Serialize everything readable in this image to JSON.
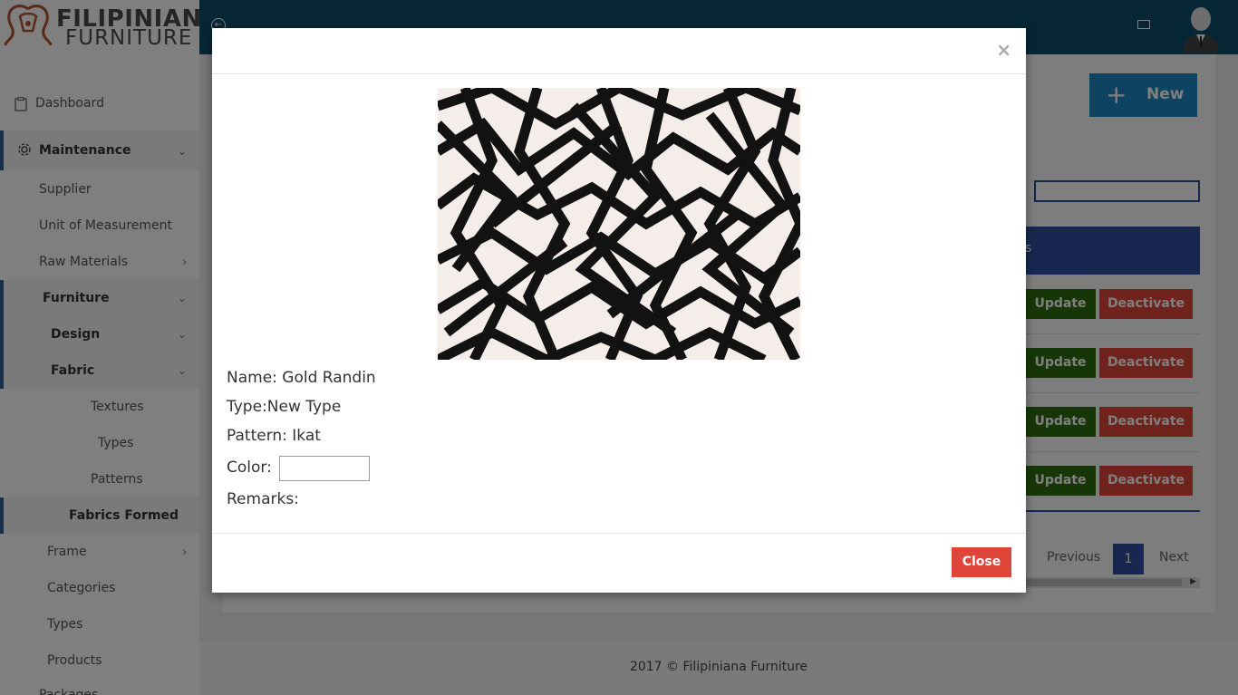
{
  "brand": {
    "line1": "FILIPINIANA",
    "line2": "FURNITURE"
  },
  "sidebar": {
    "items": [
      {
        "label": "Dashboard"
      },
      {
        "label": "Maintenance"
      },
      {
        "label": "Supplier"
      },
      {
        "label": "Unit of Measurement"
      },
      {
        "label": "Raw Materials"
      },
      {
        "label": "Furniture"
      },
      {
        "label": "Design"
      },
      {
        "label": "Fabric"
      },
      {
        "label": "Textures"
      },
      {
        "label": "Types"
      },
      {
        "label": "Patterns"
      },
      {
        "label": "Fabrics Formed"
      },
      {
        "label": "Frame"
      },
      {
        "label": "Categories"
      },
      {
        "label": "Types"
      },
      {
        "label": "Products"
      },
      {
        "label": "Packages"
      }
    ]
  },
  "main": {
    "new_button": "New",
    "table_header_fragment": "s",
    "rows": [
      {
        "update": "Update",
        "deactivate": "Deactivate"
      },
      {
        "update": "Update",
        "deactivate": "Deactivate"
      },
      {
        "update": "Update",
        "deactivate": "Deactivate"
      },
      {
        "update": "Update",
        "deactivate": "Deactivate"
      }
    ],
    "pagination": {
      "previous": "Previous",
      "current": "1",
      "next": "Next"
    }
  },
  "footer": {
    "text": "2017 © Filipiniana Furniture"
  },
  "modal": {
    "close_x": "×",
    "name": "Name: Gold Randin",
    "type": "Type:New Type",
    "pattern": "Pattern: Ikat",
    "color_label": "Color:",
    "remarks": "Remarks:",
    "close_button": "Close"
  },
  "colors": {
    "topbar": "#0f4c6b",
    "primary": "#1f87c4",
    "table_header": "#2e4ea1",
    "update": "#2e6d0e",
    "deactivate": "#e0453a",
    "close": "#e0453a"
  }
}
